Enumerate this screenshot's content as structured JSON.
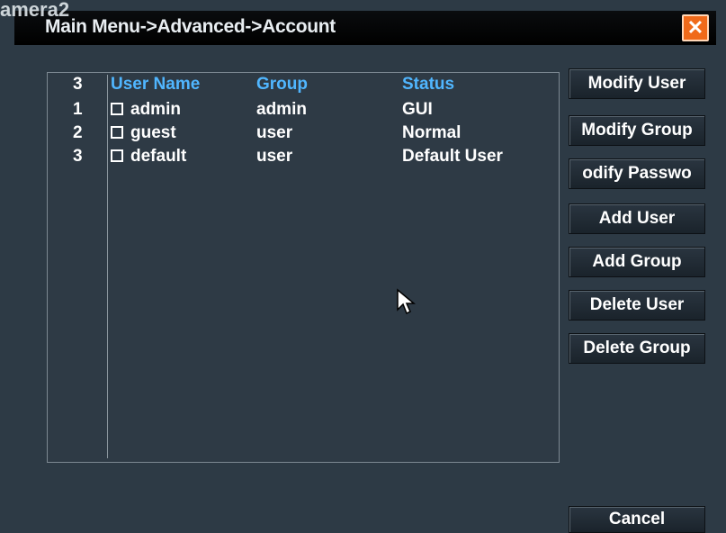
{
  "overlay": {
    "camera_label": "amera2"
  },
  "window": {
    "title": "Main Menu->Advanced->Account"
  },
  "table": {
    "count": "3",
    "headers": {
      "name": "User Name",
      "group": "Group",
      "status": "Status"
    },
    "rows": [
      {
        "num": "1",
        "name": "admin",
        "group": "admin",
        "status": "GUI"
      },
      {
        "num": "2",
        "name": "guest",
        "group": "user",
        "status": "Normal"
      },
      {
        "num": "3",
        "name": "default",
        "group": "user",
        "status": "Default User"
      }
    ]
  },
  "buttons": {
    "modify_user": "Modify User",
    "modify_group": "Modify Group",
    "modify_password": "odify Passwo",
    "add_user": "Add User",
    "add_group": "Add Group",
    "delete_user": "Delete User",
    "delete_group": "Delete Group",
    "cancel": "Cancel"
  },
  "icons": {
    "close": "close-icon",
    "cursor": "mouse-pointer-icon",
    "checkbox": "checkbox-icon"
  },
  "colors": {
    "accent_header": "#50b6ff",
    "close_button": "#f06a1a",
    "background": "#2d3a45"
  }
}
